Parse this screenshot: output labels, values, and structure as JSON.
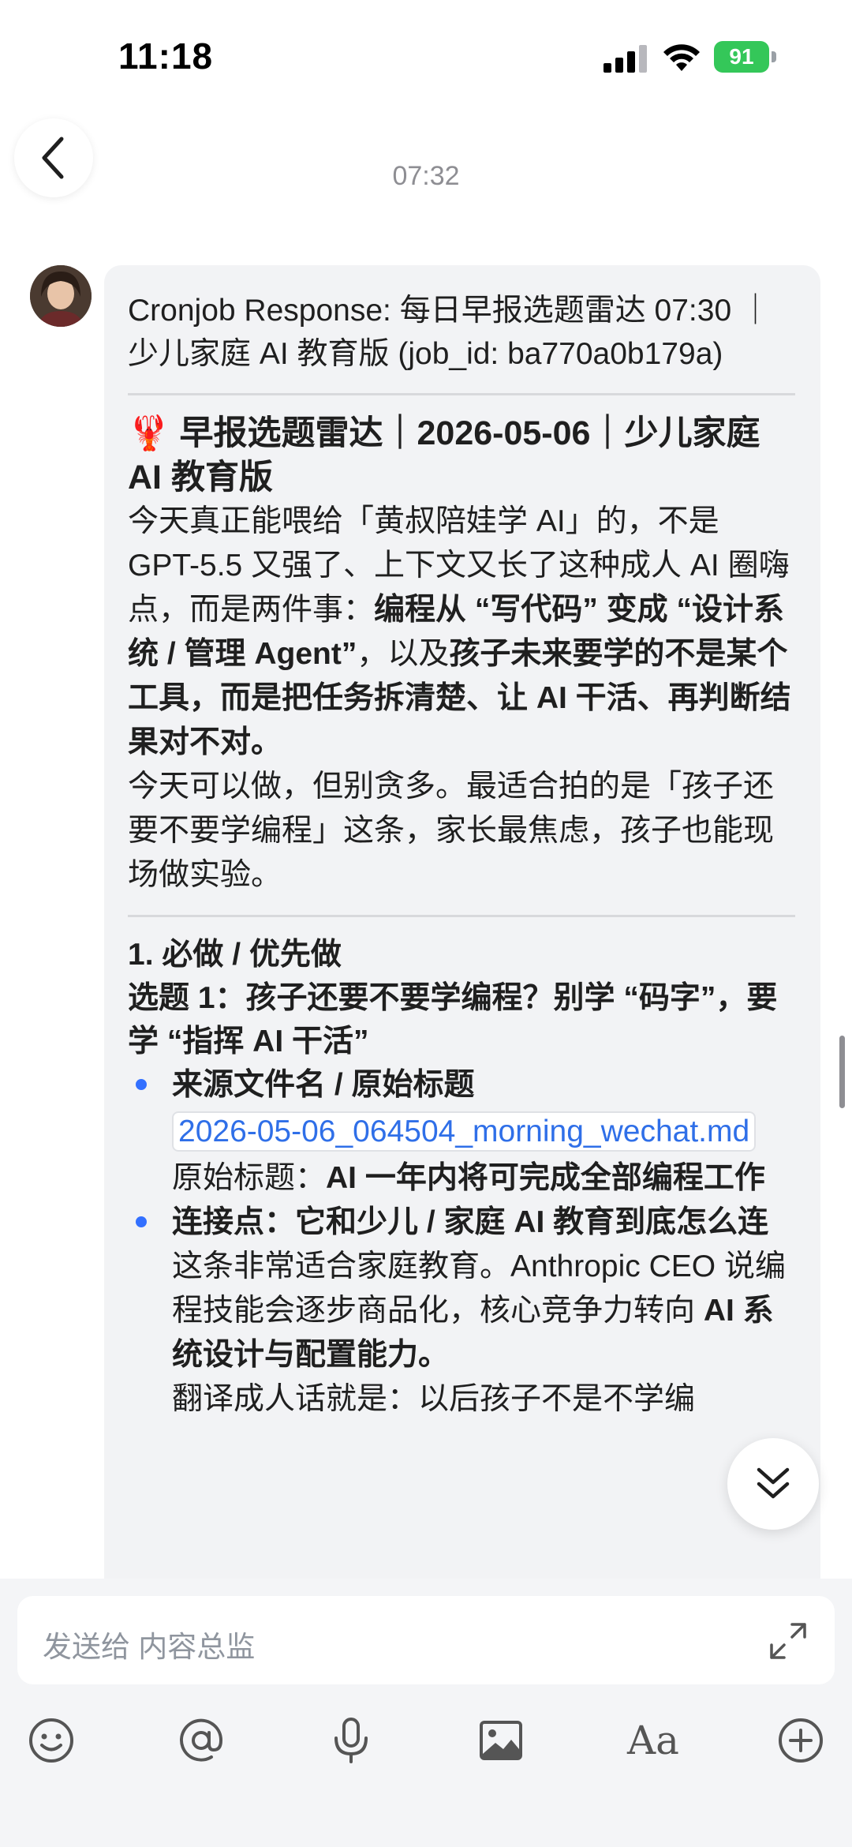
{
  "status_bar": {
    "time": "11:18",
    "battery": "91"
  },
  "chat": {
    "timestamp": "07:32",
    "message": {
      "header": "Cronjob Response: 每日早报选题雷达 07:30 ｜少儿家庭 AI 教育版 (job_id: ba770a0b179a)",
      "title": "🦞 早报选题雷达｜2026-05-06｜少儿家庭 AI 教育版",
      "intro_part1": "今天真正能喂给「黄叔陪娃学 AI」的，不是 GPT-5.5 又强了、上下文又长了这种成人 AI 圈嗨点，而是两件事：",
      "intro_bold1": "编程从 “写代码” 变成 “设计系统 / 管理 Agent”",
      "intro_part2": "，以及",
      "intro_bold2": "孩子未来要学的不是某个工具，而是把任务拆清楚、让 AI 干活、再判断结果对不对。",
      "advice": "今天可以做，但别贪多。最适合拍的是「孩子还要不要学编程」这条，家长最焦虑，孩子也能现场做实验。",
      "section_title": "1. 必做 / 优先做",
      "topic_title": "选题 1：孩子还要不要学编程？别学 “码字”，要学 “指挥 AI 干活”",
      "bullets": [
        {
          "title": "来源文件名 / 原始标题",
          "file": "2026-05-06_064504_morning_wechat.md",
          "label": "原始标题：",
          "value": "AI 一年内将可完成全部编程工作"
        },
        {
          "title": "连接点：它和少儿 / 家庭 AI 教育到底怎么连",
          "text1": "这条非常适合家庭教育。Anthropic CEO 说编程技能会逐步商品化，核心竞争力转向 ",
          "bold": "AI 系统设计与配置能力。",
          "text2": "翻译成人话就是：以后孩子不是不学编"
        }
      ]
    }
  },
  "composer": {
    "placeholder": "发送给 内容总监"
  },
  "toolbar": {
    "font_label": "Aa"
  }
}
